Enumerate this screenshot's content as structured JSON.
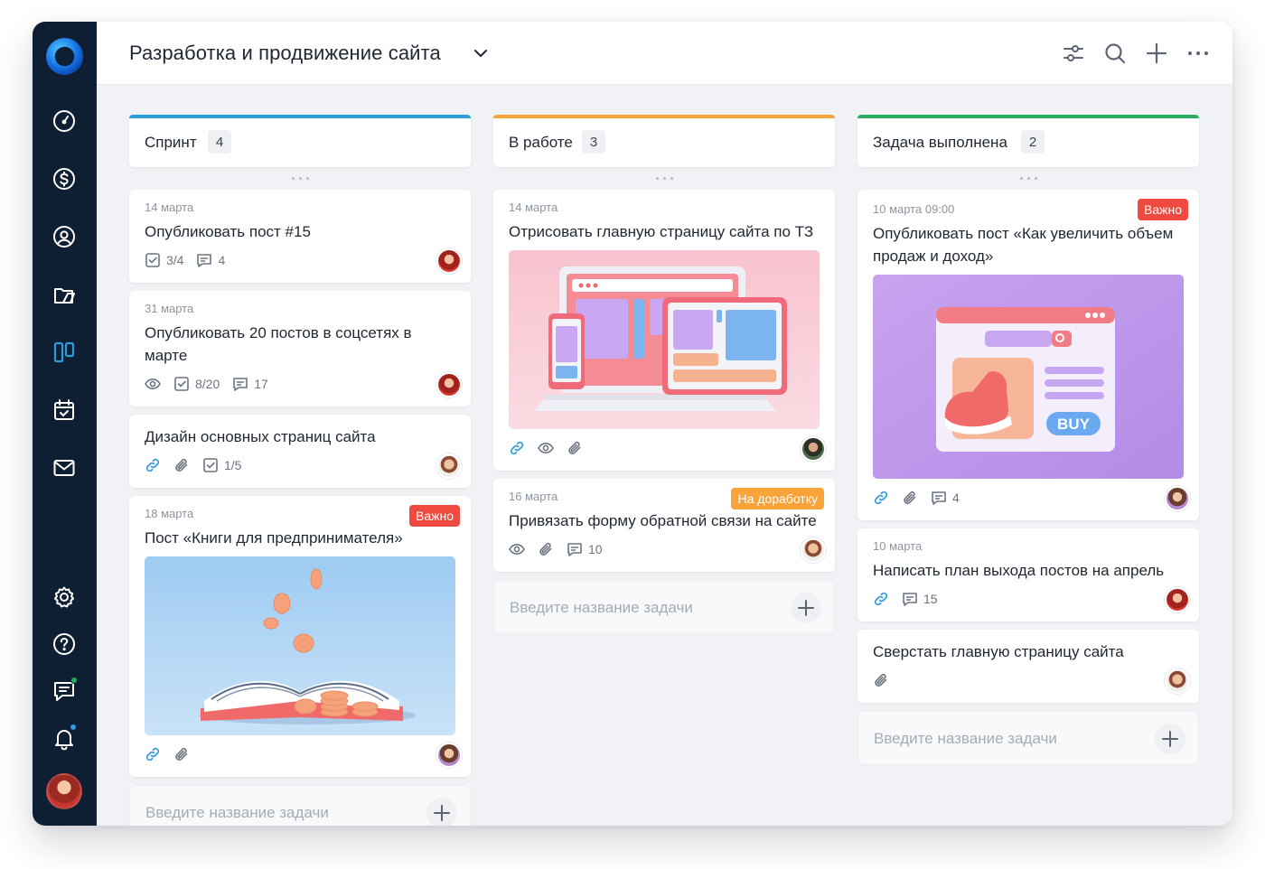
{
  "project": {
    "title": "Разработка и продвижение сайта"
  },
  "colors": {
    "sidebar": "#0f1f33",
    "accent_blue": "#2d9cdb",
    "orange": "#f9a43a",
    "green": "#27ae60",
    "important": "#ef4a3f"
  },
  "sidebar": {
    "items": [
      "dashboard-icon",
      "dollar-icon",
      "user-icon",
      "folder-icon",
      "kanban-icon",
      "calendar-icon",
      "mail-icon",
      "gear-icon",
      "help-icon",
      "chat-icon",
      "bell-icon"
    ],
    "active": "kanban-icon"
  },
  "toolbar": {
    "tools": [
      "filter-icon",
      "search-icon",
      "plus-icon",
      "more-icon"
    ]
  },
  "columns": [
    {
      "title": "Спринт",
      "count": "4",
      "cards": [
        {
          "date": "14 марта",
          "title": "Опубликовать пост #15",
          "checklist": "3/4",
          "comments": "4"
        },
        {
          "date": "31 марта",
          "title": "Опубликовать 20 постов в соцсетях в марте",
          "checklist": "8/20",
          "comments": "17"
        },
        {
          "title": "Дизайн основных страниц сайта",
          "checklist": "1/5"
        },
        {
          "date": "18 марта",
          "title": "Пост «Книги для предпринимателя»",
          "badge": "Важно"
        }
      ],
      "add_placeholder": "Введите название задачи"
    },
    {
      "title": "В работе",
      "count": "3",
      "cards": [
        {
          "date": "14 марта",
          "title": "Отрисовать главную страницу сайта по ТЗ"
        },
        {
          "date": "16 марта",
          "title": "Привязать форму обратной связи на сайте",
          "badge": "На доработку",
          "comments": "10"
        }
      ],
      "add_placeholder": "Введите название задачи"
    },
    {
      "title": "Задача выполнена",
      "count": "2",
      "cards": [
        {
          "date": "10 марта 09:00",
          "title": "Опубликовать пост «Как увеличить объем продаж и доход»",
          "badge": "Важно",
          "comments": "4",
          "image_text": "BUY"
        },
        {
          "date": "10 марта",
          "title": "Написать план выхода постов на апрель",
          "comments": "15"
        },
        {
          "title": "Сверстать главную страницу сайта"
        }
      ],
      "add_placeholder": "Введите название задачи"
    }
  ]
}
